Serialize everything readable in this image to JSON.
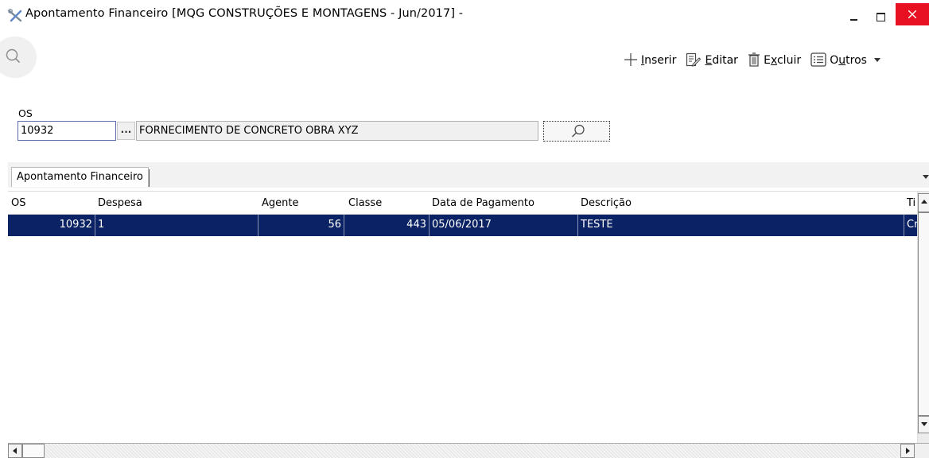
{
  "window": {
    "title": "Apontamento Financeiro [MQG CONSTRUÇÕES E MONTAGENS - Jun/2017]  -",
    "icon": "tools-icon"
  },
  "toolbar": {
    "inserir_pre": "",
    "inserir_u": "I",
    "inserir_post": "nserir",
    "editar_u": "E",
    "editar_post": "ditar",
    "excluir_pre": "E",
    "excluir_u": "x",
    "excluir_post": "cluir",
    "outros_pre": "O",
    "outros_u": "u",
    "outros_post": "tros"
  },
  "filter": {
    "os_label": "OS",
    "os_value": "10932",
    "ellipsis": "...",
    "description": "FORNECIMENTO DE CONCRETO OBRA XYZ"
  },
  "tabs": [
    {
      "label": "Apontamento Financeiro"
    }
  ],
  "grid": {
    "columns": [
      "OS",
      "Despesa",
      "Agente",
      "Classe",
      "Data de Pagamento",
      "Descrição",
      "Ti"
    ],
    "rows": [
      {
        "os": "10932",
        "despesa": "1",
        "agente": "56",
        "classe": "443",
        "data_pagamento": "05/06/2017",
        "descricao": "TESTE",
        "ti": "Cr"
      }
    ]
  },
  "colors": {
    "selected_row": "#0b2365",
    "close_button": "#e81123"
  }
}
